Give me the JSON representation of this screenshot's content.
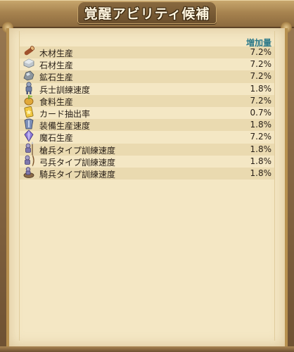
{
  "title": "覚醒アビリティ候補",
  "column_header": "増加量",
  "rows": [
    {
      "icon": "wood-log-icon",
      "label": "木材生産",
      "value": "7.2%"
    },
    {
      "icon": "stone-block-icon",
      "label": "石材生産",
      "value": "7.2%"
    },
    {
      "icon": "ore-icon",
      "label": "鉱石生産",
      "value": "7.2%"
    },
    {
      "icon": "soldier-icon",
      "label": "兵士訓練速度",
      "value": "1.8%"
    },
    {
      "icon": "food-icon",
      "label": "食料生産",
      "value": "7.2%"
    },
    {
      "icon": "card-icon",
      "label": "カード抽出率",
      "value": "0.7%"
    },
    {
      "icon": "armor-icon",
      "label": "装備生産速度",
      "value": "1.8%"
    },
    {
      "icon": "magic-stone-icon",
      "label": "魔石生産",
      "value": "7.2%"
    },
    {
      "icon": "spearman-icon",
      "label": "槍兵タイプ訓練速度",
      "value": "1.8%"
    },
    {
      "icon": "archer-icon",
      "label": "弓兵タイプ訓練速度",
      "value": "1.8%"
    },
    {
      "icon": "cavalry-icon",
      "label": "騎兵タイプ訓練速度",
      "value": "1.8%"
    }
  ]
}
